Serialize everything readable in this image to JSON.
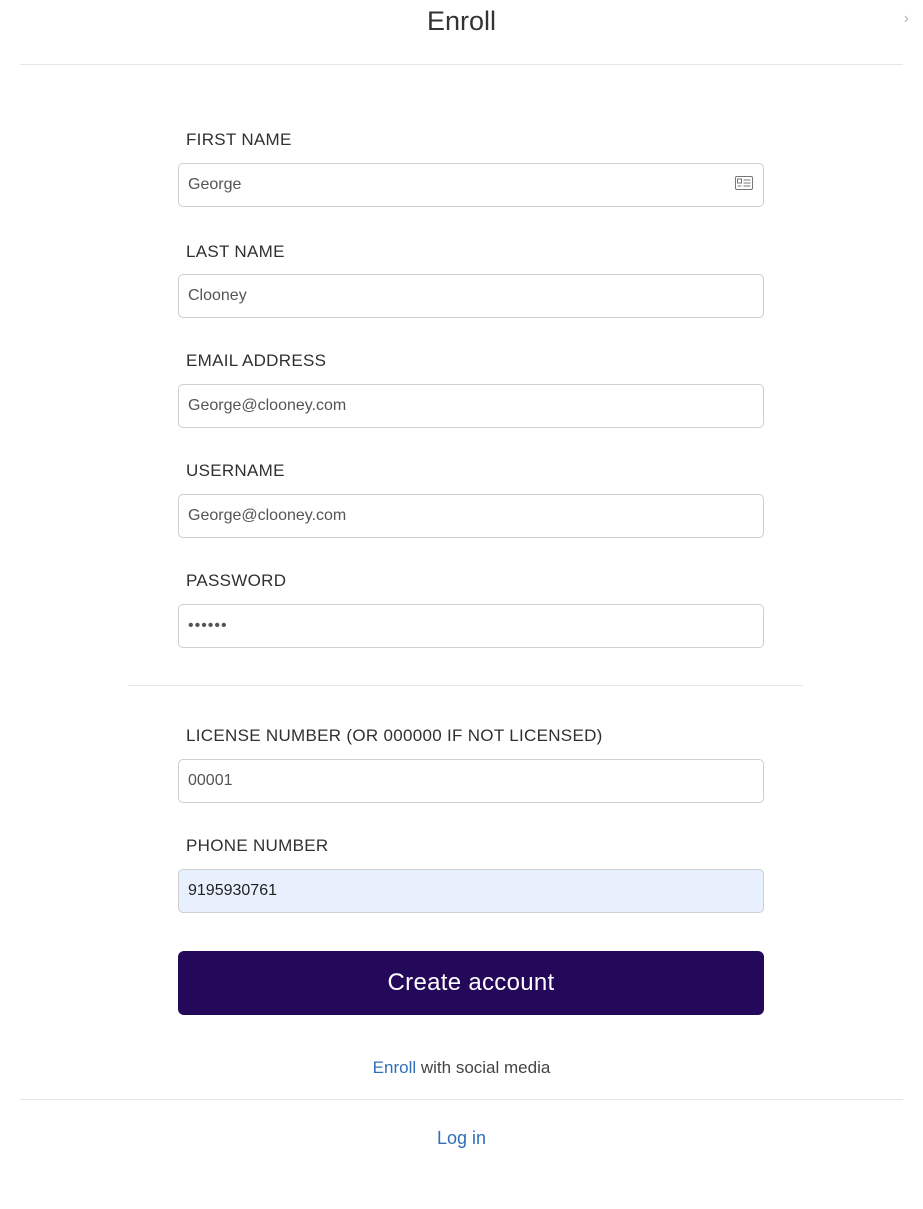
{
  "header": {
    "title": "Enroll",
    "close_glyph": "›"
  },
  "form": {
    "first_name": {
      "label": "FIRST NAME",
      "value": "George",
      "icon": "contact-card-icon"
    },
    "last_name": {
      "label": "LAST NAME",
      "value": "Clooney"
    },
    "email": {
      "label": "EMAIL ADDRESS",
      "value": "George@clooney.com"
    },
    "username": {
      "label": "USERNAME",
      "value": "George@clooney.com"
    },
    "password": {
      "label": "PASSWORD",
      "value": "••••••"
    },
    "license": {
      "label": "LICENSE NUMBER (OR 000000 IF NOT LICENSED)",
      "value": "00001"
    },
    "phone": {
      "label": "PHONE NUMBER",
      "value": "9195930761"
    }
  },
  "actions": {
    "create_account_label": "Create account",
    "social_link": "Enroll",
    "social_text": " with social media",
    "login_label": "Log in"
  },
  "colors": {
    "primary_button": "#24095a",
    "link": "#2f6fb7",
    "autofill_bg": "#e8f0fe"
  }
}
